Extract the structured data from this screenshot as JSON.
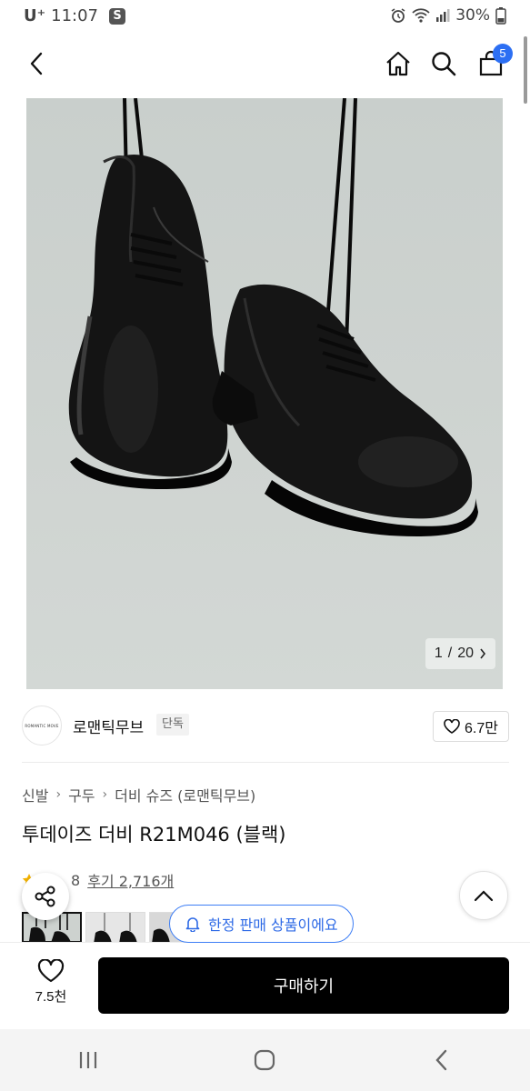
{
  "status_bar": {
    "carrier": "U⁺",
    "time": "11:07",
    "app_badge": "S",
    "battery": "30%"
  },
  "header": {
    "cart_count": "5"
  },
  "gallery": {
    "current": "1",
    "separator": "/",
    "total": "20"
  },
  "brand": {
    "logo_text": "ROMANTIC MOVE",
    "name": "로맨틱무브",
    "tag": "단독",
    "likes": "6.7만"
  },
  "breadcrumb": [
    "신발",
    "구두",
    "더비 슈즈 (로맨틱무브)"
  ],
  "product": {
    "title": "투데이즈 더비 R21M046 (블랙)",
    "rating_partial": "8",
    "review_label": "후기 2,716개"
  },
  "limited_notice": "한정 판매 상품이에요",
  "bottom_bar": {
    "wish_count": "7.5천",
    "buy_label": "구매하기"
  },
  "colors": {
    "accent": "#2c6ff3",
    "buy_button": "#000000"
  }
}
